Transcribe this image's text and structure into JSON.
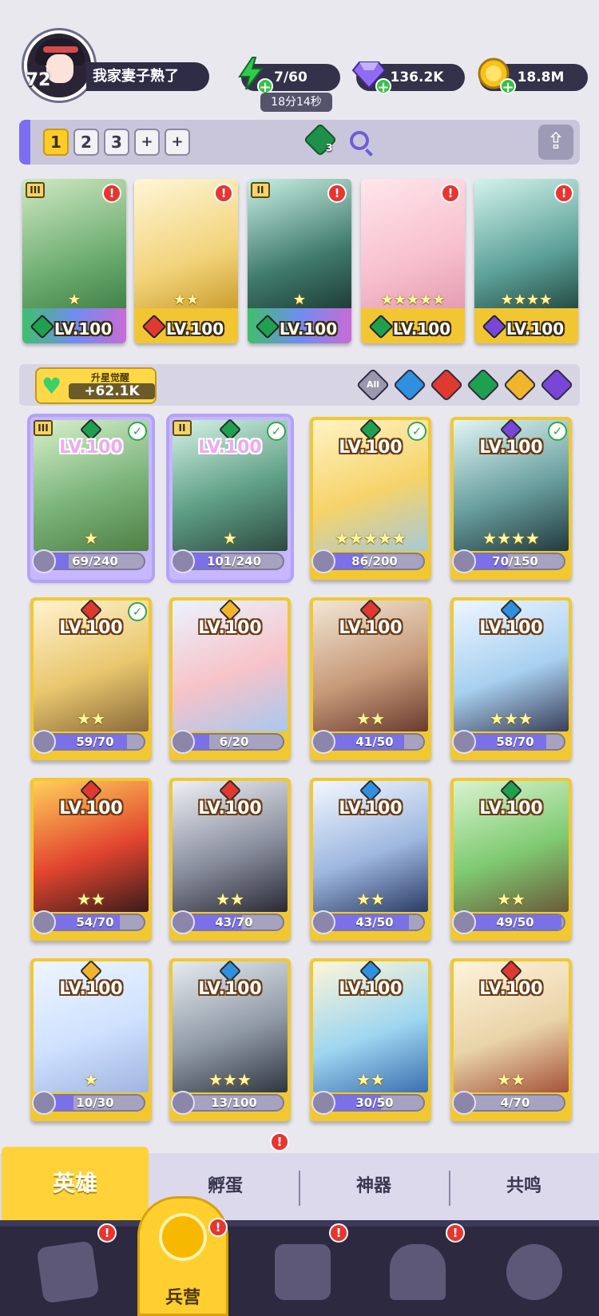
{
  "player": {
    "level": "72",
    "name": "我家妻子熟了"
  },
  "resources": {
    "stamina": "7/60",
    "stamina_timer": "18分14秒",
    "gems": "136.2K",
    "gold": "18.8M"
  },
  "team_tabs": [
    "1",
    "2",
    "3",
    "+",
    "+"
  ],
  "team_power_badge": "3",
  "team_slots": [
    {
      "rank": "III",
      "level": "LV.100",
      "stars": "★",
      "element": "green",
      "alert": "!"
    },
    {
      "rank": "",
      "level": "LV.100",
      "stars": "★★",
      "element": "red",
      "alert": "!"
    },
    {
      "rank": "II",
      "level": "LV.100",
      "stars": "★",
      "element": "green",
      "alert": "!"
    },
    {
      "rank": "",
      "level": "LV.100",
      "stars": "★★★★★",
      "element": "green",
      "alert": "!"
    },
    {
      "rank": "",
      "level": "LV.100",
      "stars": "★★★★",
      "element": "purple",
      "alert": "!"
    }
  ],
  "awake": {
    "label": "升星觉醒",
    "value": "+62.1K"
  },
  "filters": [
    "All",
    "",
    "",
    "",
    "",
    ""
  ],
  "heroes": [
    {
      "level": "LV.100",
      "shards": "69/240",
      "progress": 0.29,
      "element": "green",
      "stars": "★",
      "in_team": true,
      "rank": "III",
      "checked": true
    },
    {
      "level": "LV.100",
      "shards": "101/240",
      "progress": 0.42,
      "element": "green",
      "stars": "★",
      "in_team": true,
      "rank": "II",
      "checked": true
    },
    {
      "level": "LV.100",
      "shards": "86/200",
      "progress": 0.43,
      "element": "green",
      "stars": "★★★★★",
      "in_team": false,
      "rank": "",
      "checked": true
    },
    {
      "level": "LV.100",
      "shards": "70/150",
      "progress": 0.47,
      "element": "purple",
      "stars": "★★★★",
      "in_team": false,
      "rank": "",
      "checked": true
    },
    {
      "level": "LV.100",
      "shards": "59/70",
      "progress": 0.84,
      "element": "red",
      "stars": "★★",
      "in_team": false,
      "rank": "",
      "checked": true
    },
    {
      "level": "LV.100",
      "shards": "6/20",
      "progress": 0.3,
      "element": "gold",
      "stars": "",
      "in_team": false,
      "rank": "",
      "checked": false
    },
    {
      "level": "LV.100",
      "shards": "41/50",
      "progress": 0.82,
      "element": "red",
      "stars": "★★",
      "in_team": false,
      "rank": "",
      "checked": false
    },
    {
      "level": "LV.100",
      "shards": "58/70",
      "progress": 0.83,
      "element": "blue",
      "stars": "★★★",
      "in_team": false,
      "rank": "",
      "checked": false
    },
    {
      "level": "LV.100",
      "shards": "54/70",
      "progress": 0.77,
      "element": "red",
      "stars": "★★",
      "in_team": false,
      "rank": "",
      "checked": false
    },
    {
      "level": "LV.100",
      "shards": "43/70",
      "progress": 0.61,
      "element": "red",
      "stars": "★★",
      "in_team": false,
      "rank": "",
      "checked": false
    },
    {
      "level": "LV.100",
      "shards": "43/50",
      "progress": 0.86,
      "element": "blue",
      "stars": "★★",
      "in_team": false,
      "rank": "",
      "checked": false
    },
    {
      "level": "LV.100",
      "shards": "49/50",
      "progress": 0.98,
      "element": "green",
      "stars": "★★",
      "in_team": false,
      "rank": "",
      "checked": false
    },
    {
      "level": "LV.100",
      "shards": "10/30",
      "progress": 0.33,
      "element": "gold",
      "stars": "★",
      "in_team": false,
      "rank": "",
      "checked": false
    },
    {
      "level": "LV.100",
      "shards": "13/100",
      "progress": 0.13,
      "element": "blue",
      "stars": "★★★",
      "in_team": false,
      "rank": "",
      "checked": false
    },
    {
      "level": "LV.100",
      "shards": "30/50",
      "progress": 0.6,
      "element": "blue",
      "stars": "★★",
      "in_team": false,
      "rank": "",
      "checked": false
    },
    {
      "level": "LV.100",
      "shards": "4/70",
      "progress": 0.06,
      "element": "red",
      "stars": "★★",
      "in_team": false,
      "rank": "",
      "checked": false
    }
  ],
  "sub_tabs": [
    "英雄",
    "孵蛋",
    "神器",
    "共鸣"
  ],
  "sub_tab_alert": "!",
  "bottom_nav": {
    "active_label": "兵营",
    "alert": "!"
  },
  "colors": {
    "green": "#1fa04f",
    "red": "#e0392f",
    "blue": "#2f8fe0",
    "purple": "#7a46d8",
    "gold": "#f0b52a",
    "all": "#9b98ad"
  }
}
